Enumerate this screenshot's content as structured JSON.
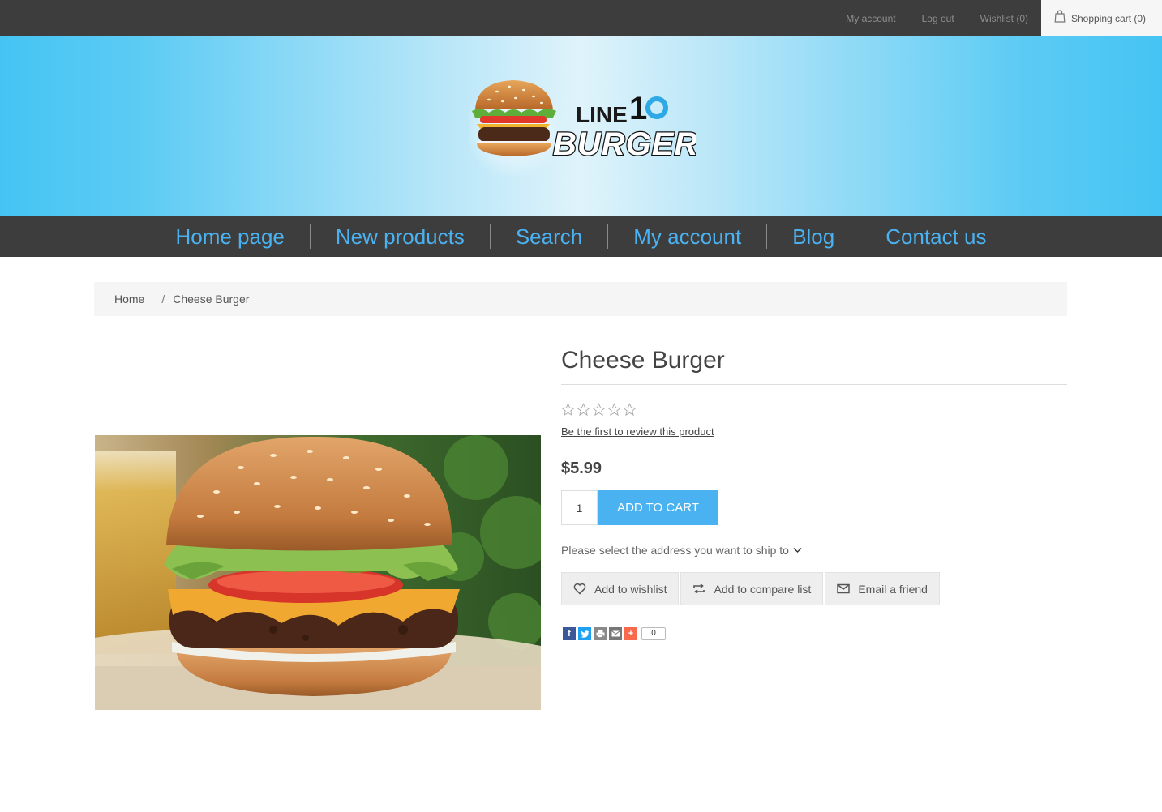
{
  "topbar": {
    "links": [
      "My account",
      "Log out",
      "Wishlist (0)"
    ],
    "cart_label": "Shopping cart (0)"
  },
  "header": {
    "logo_text_line1": "LINE 10",
    "logo_text_line2": "BURGERS"
  },
  "nav": {
    "items": [
      "Home page",
      "New products",
      "Search",
      "My account",
      "Blog",
      "Contact us"
    ]
  },
  "breadcrumb": {
    "home": "Home",
    "separator": "/",
    "current": "Cheese Burger"
  },
  "product": {
    "title": "Cheese Burger",
    "rating_stars": 0,
    "rating_max": 5,
    "review_link": "Be the first to review this product",
    "price": "$5.99",
    "quantity": "1",
    "add_to_cart": "ADD TO CART",
    "ship_prompt": "Please select the address you want to ship to",
    "actions": {
      "wishlist": "Add to wishlist",
      "compare": "Add to compare list",
      "email": "Email a friend"
    },
    "share_count": "0"
  },
  "colors": {
    "accent": "#4ab2f1",
    "bar": "#3d3d3d",
    "header_edge": "#45c4f3"
  },
  "icons": {
    "cart": "shopping-bag-icon",
    "wishlist": "heart-icon",
    "compare": "compare-arrows-icon",
    "email": "envelope-icon",
    "ship": "chevron-down-icon",
    "share": [
      "facebook-icon",
      "twitter-icon",
      "print-icon",
      "email-share-icon",
      "plus-share-icon"
    ]
  }
}
